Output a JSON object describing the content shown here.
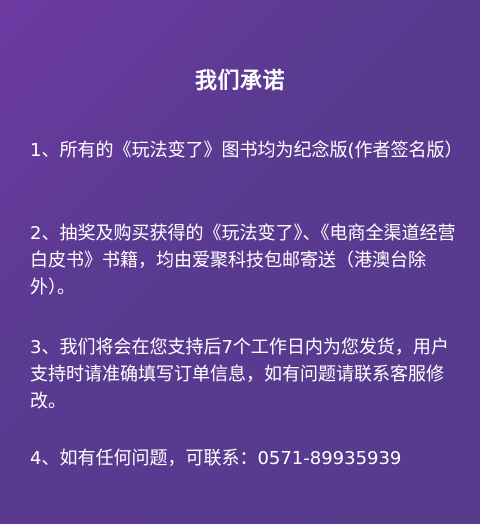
{
  "title": "我们承诺",
  "paragraphs": [
    "1、所有的《玩法变了》图书均为纪念版(作者签名版）",
    "2、抽奖及购买获得的《玩法变了》、《电商全渠道经营白皮书》书籍，均由爱聚科技包邮寄送（港澳台除外）。",
    "3、我们将会在您支持后7个工作日内为您发货，用户支持时请准确填写订单信息，如有问题请联系客服修改。",
    "4、如有任何问题，可联系：0571-89935939"
  ],
  "colors": {
    "background": "#5b3a92",
    "text": "#ffffff"
  }
}
